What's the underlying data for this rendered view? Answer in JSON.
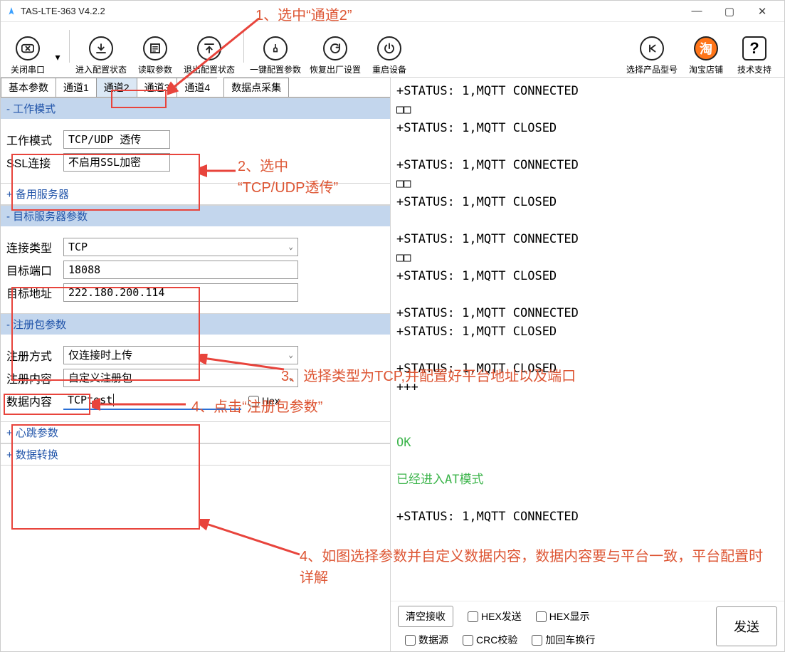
{
  "window_title": "TAS-LTE-363 V4.2.2",
  "toolbar": {
    "close_serial": "关闭串口",
    "enter_config": "进入配置状态",
    "read_params": "读取参数",
    "exit_config": "退出配置状态",
    "oneclick_config": "一键配置参数",
    "restore_factory": "恢复出厂设置",
    "reboot": "重启设备",
    "select_product": "选择产品型号",
    "taobao": "淘宝店铺",
    "support": "技术支持",
    "tao_char": "淘"
  },
  "tabs": {
    "basic": "基本参数",
    "ch1": "通道1",
    "ch2": "通道2",
    "ch3": "通道3",
    "ch4": "通道4",
    "datapoint": "数据点采集"
  },
  "sections": {
    "work_mode": "- 工作模式",
    "backup_server": "+ 备用服务器",
    "target_server": "- 目标服务器参数",
    "register": "- 注册包参数",
    "heartbeat": "+ 心跳参数",
    "convert": "+ 数据转换"
  },
  "fields": {
    "work_mode_label": "工作模式",
    "work_mode_value": "TCP/UDP 透传",
    "ssl_label": "SSL连接",
    "ssl_value": "不启用SSL加密",
    "conn_type_label": "连接类型",
    "conn_type_value": "TCP",
    "target_port_label": "目标端口",
    "target_port_value": "18088",
    "target_addr_label": "目标地址",
    "target_addr_value": "222.180.200.114",
    "reg_mode_label": "注册方式",
    "reg_mode_value": "仅连接时上传",
    "reg_content_label": "注册内容",
    "reg_content_value": "自定义注册包",
    "data_content_label": "数据内容",
    "data_content_value": "TCPtest",
    "hex_label": "Hex"
  },
  "log": {
    "status_connected": "+STATUS: 1,MQTT CONNECTED",
    "status_closed": "+STATUS: 1,MQTT CLOSED",
    "boxes": "□□",
    "plus": "+++",
    "empty": "",
    "ok": "OK",
    "at_mode": "已经进入AT模式"
  },
  "bottom": {
    "clear_recv": "清空接收",
    "data_src": "数据源",
    "hex_send": "HEX发送",
    "crc": "CRC校验",
    "hex_show": "HEX显示",
    "add_cr": "加回车换行",
    "send": "发送"
  },
  "annots": {
    "a1": "1、选中“通道2”",
    "a2a": "2、选中",
    "a2b": "“TCP/UDP透传”",
    "a3": "3、选择类型为TCP,并配置好平台地址以及端口",
    "a4a": "4、点击“注册包参数”",
    "a4b": "4、如图选择参数并自定义数据内容，数据内容要与平台一致，平台配置时详解"
  }
}
